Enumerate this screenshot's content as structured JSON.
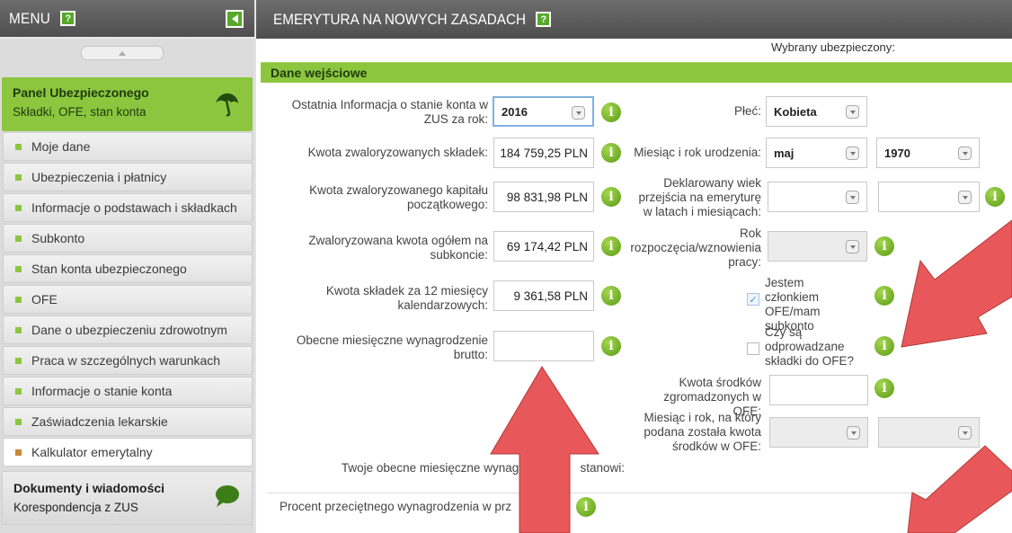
{
  "sidebar": {
    "menu_title": "MENU",
    "help_glyph": "?",
    "panel_main": {
      "title": "Panel Ubezpieczonego",
      "subtitle": "Składki, OFE, stan konta",
      "icon": "umbrella-icon"
    },
    "items": [
      {
        "label": "Moje dane",
        "active": false
      },
      {
        "label": "Ubezpieczenia i płatnicy",
        "active": false
      },
      {
        "label": "Informacje o podstawach i składkach",
        "active": false
      },
      {
        "label": "Subkonto",
        "active": false
      },
      {
        "label": "Stan konta ubezpieczonego",
        "active": false
      },
      {
        "label": "OFE",
        "active": false
      },
      {
        "label": "Dane o ubezpieczeniu zdrowotnym",
        "active": false
      },
      {
        "label": "Praca w szczególnych warunkach",
        "active": false
      },
      {
        "label": "Informacje o stanie konta",
        "active": false
      },
      {
        "label": "Zaświadczenia lekarskie",
        "active": false
      },
      {
        "label": "Kalkulator emerytalny",
        "active": true
      }
    ],
    "panel_docs": {
      "title": "Dokumenty i wiadomości",
      "subtitle": "Korespondencja z ZUS",
      "icon": "speech-bubble-icon"
    }
  },
  "main": {
    "title": "EMERYTURA NA NOWYCH ZASADACH",
    "help_glyph": "?",
    "selected_insured": "Wybrany ubezpieczony:",
    "section_title": "Dane wejściowe",
    "info_glyph": "i",
    "left": {
      "last_info_label": "Ostatnia Informacja o stanie konta w ZUS za rok:",
      "last_info_year": "2016",
      "contrib_label": "Kwota zwaloryzowanych składek:",
      "contrib_value": "184 759,25 PLN",
      "capital_label": "Kwota zwaloryzowanego kapitału początkowego:",
      "capital_value": "98 831,98 PLN",
      "subaccount_label": "Zwaloryzowana kwota ogółem na subkoncie:",
      "subaccount_value": "69 174,42 PLN",
      "contrib12_label": "Kwota składek za 12 miesięcy kalendarzowych:",
      "contrib12_value": "9 361,58 PLN",
      "salary_label": "Obecne miesięczne wynagrodzenie brutto:",
      "salary_value": ""
    },
    "right": {
      "gender_label": "Płeć:",
      "gender_value": "Kobieta",
      "birth_label": "Miesiąc i rok urodzenia:",
      "birth_month": "maj",
      "birth_year": "1970",
      "retire_age_label": "Deklarowany wiek przejścia na emeryturę w latach i miesiącach:",
      "work_start_label": "Rok rozpoczęcia/wznowienia pracy:",
      "ofe_member_label": "Jestem członkiem OFE/mam subkonto",
      "ofe_member_checked": true,
      "ofe_contrib_label": "Czy są odprowadzane składki do OFE?",
      "ofe_contrib_checked": false,
      "ofe_funds_label": "Kwota środków zgromadzonych w OFE:",
      "ofe_date_label": "Miesiąc i rok, na który podana została kwota środków w OFE:"
    },
    "salary_now_label": "Twoje obecne miesięczne wynagr                 stanowi:",
    "percent_label": "Procent przeciętnego wynagrodzenia w prz"
  },
  "colors": {
    "accent_green": "#8cc63f",
    "header_gray": "#5a5a5a",
    "arrow_red": "#e8585a"
  }
}
